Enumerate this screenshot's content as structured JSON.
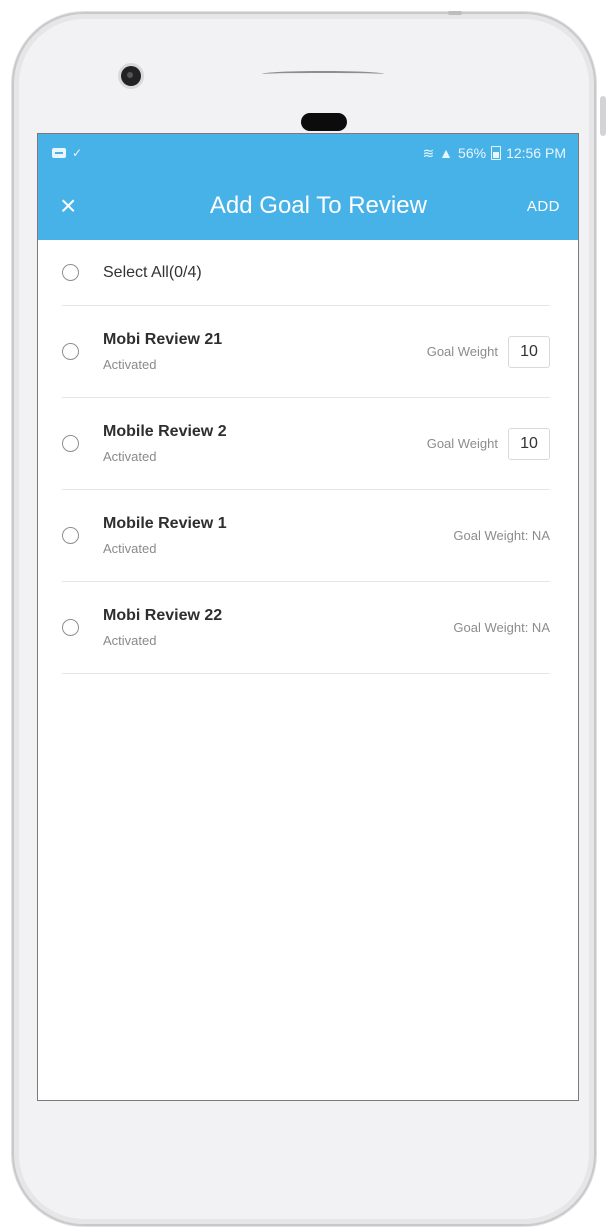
{
  "status_bar": {
    "signal_text": "56%",
    "time": "12:56 PM"
  },
  "app_bar": {
    "close_icon": "×",
    "title": "Add Goal To Review",
    "add_label": "ADD"
  },
  "select_all": {
    "label": "Select All(0/4)"
  },
  "goals": [
    {
      "name": "Mobi Review 21",
      "status": "Activated",
      "weight_label": "Goal Weight",
      "weight_value": "10"
    },
    {
      "name": "Mobile Review 2",
      "status": "Activated",
      "weight_label": "Goal Weight",
      "weight_value": "10"
    },
    {
      "name": "Mobile Review 1",
      "status": "Activated",
      "weight_na": "Goal Weight: NA"
    },
    {
      "name": "Mobi Review 22",
      "status": "Activated",
      "weight_na": "Goal Weight: NA"
    }
  ],
  "colors": {
    "accent": "#46b2e8"
  }
}
